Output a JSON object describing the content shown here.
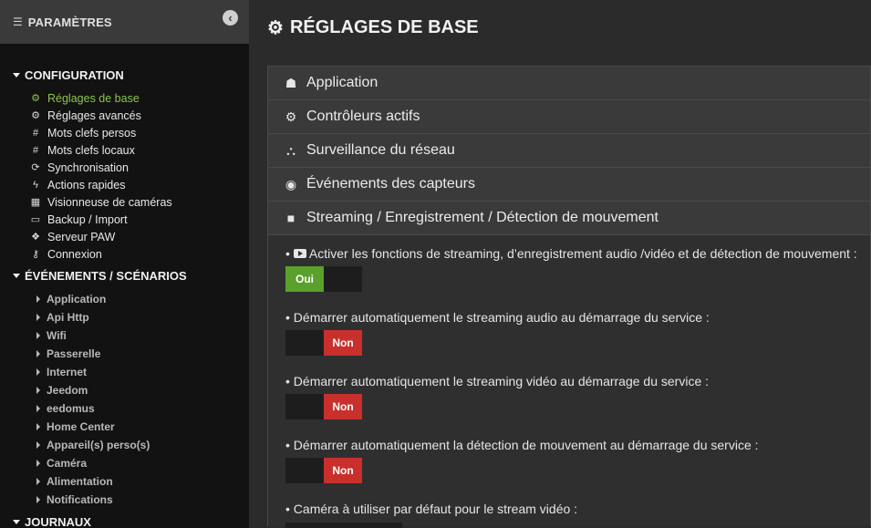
{
  "sidebar": {
    "header_title": "PARAMÈTRES",
    "config_title": "CONFIGURATION",
    "config_items": [
      {
        "label": "Réglages de base",
        "icon": "gear-icon",
        "glyph": "⚙",
        "active": true
      },
      {
        "label": "Réglages avancés",
        "icon": "gears-icon",
        "glyph": "⚙",
        "active": false
      },
      {
        "label": "Mots clefs persos",
        "icon": "hashtag-icon",
        "glyph": "#",
        "active": false
      },
      {
        "label": "Mots clefs locaux",
        "icon": "hashtag-icon",
        "glyph": "#",
        "active": false
      },
      {
        "label": "Synchronisation",
        "icon": "sync-icon",
        "glyph": "⟳",
        "active": false
      },
      {
        "label": "Actions rapides",
        "icon": "bolt-icon",
        "glyph": "ϟ",
        "active": false
      },
      {
        "label": "Visionneuse de caméras",
        "icon": "grid-icon",
        "glyph": "▦",
        "active": false
      },
      {
        "label": "Backup / Import",
        "icon": "drive-icon",
        "glyph": "▭",
        "active": false
      },
      {
        "label": "Serveur PAW",
        "icon": "paw-icon",
        "glyph": "❖",
        "active": false
      },
      {
        "label": "Connexion",
        "icon": "key-icon",
        "glyph": "⚷",
        "active": false
      }
    ],
    "events_title": "ÉVÉNEMENTS / SCÉNARIOS",
    "event_items": [
      "Application",
      "Api Http",
      "Wifi",
      "Passerelle",
      "Internet",
      "Jeedom",
      "eedomus",
      "Home Center",
      "Appareil(s) perso(s)",
      "Caméra",
      "Alimentation",
      "Notifications"
    ],
    "next_section_title": "JOURNAUX"
  },
  "main": {
    "title": "RÉGLAGES DE BASE",
    "panels": [
      {
        "label": "Application",
        "icon": "android-icon",
        "glyph": "☗"
      },
      {
        "label": "Contrôleurs actifs",
        "icon": "gear-icon",
        "glyph": "⚙"
      },
      {
        "label": "Surveillance du réseau",
        "icon": "sitemap-icon",
        "glyph": "⛬"
      },
      {
        "label": "Événements des capteurs",
        "icon": "eye-icon",
        "glyph": "◉"
      },
      {
        "label": "Streaming / Enregistrement / Détection de mouvement",
        "icon": "video-camera-icon",
        "glyph": "■"
      }
    ],
    "options": [
      {
        "label": "Activer les fonctions de streaming, d’enregistrement audio /vidéo et de détection de mouvement :",
        "state": "Oui",
        "has_icon": true
      },
      {
        "label": "Démarrer automatiquement le streaming audio au démarrage du service :",
        "state": "Non",
        "has_icon": false
      },
      {
        "label": "Démarrer automatiquement le streaming vidéo au démarrage du service :",
        "state": "Non",
        "has_icon": false
      },
      {
        "label": "Démarrer automatiquement la détection de mouvement au démarrage du service :",
        "state": "Non",
        "has_icon": false
      }
    ],
    "camera_option_label": "Caméra à utiliser par défaut pour le stream vidéo :"
  },
  "colors": {
    "accent_green": "#8cc34a",
    "toggle_on": "#5aa02c",
    "toggle_off": "#c9302c"
  }
}
